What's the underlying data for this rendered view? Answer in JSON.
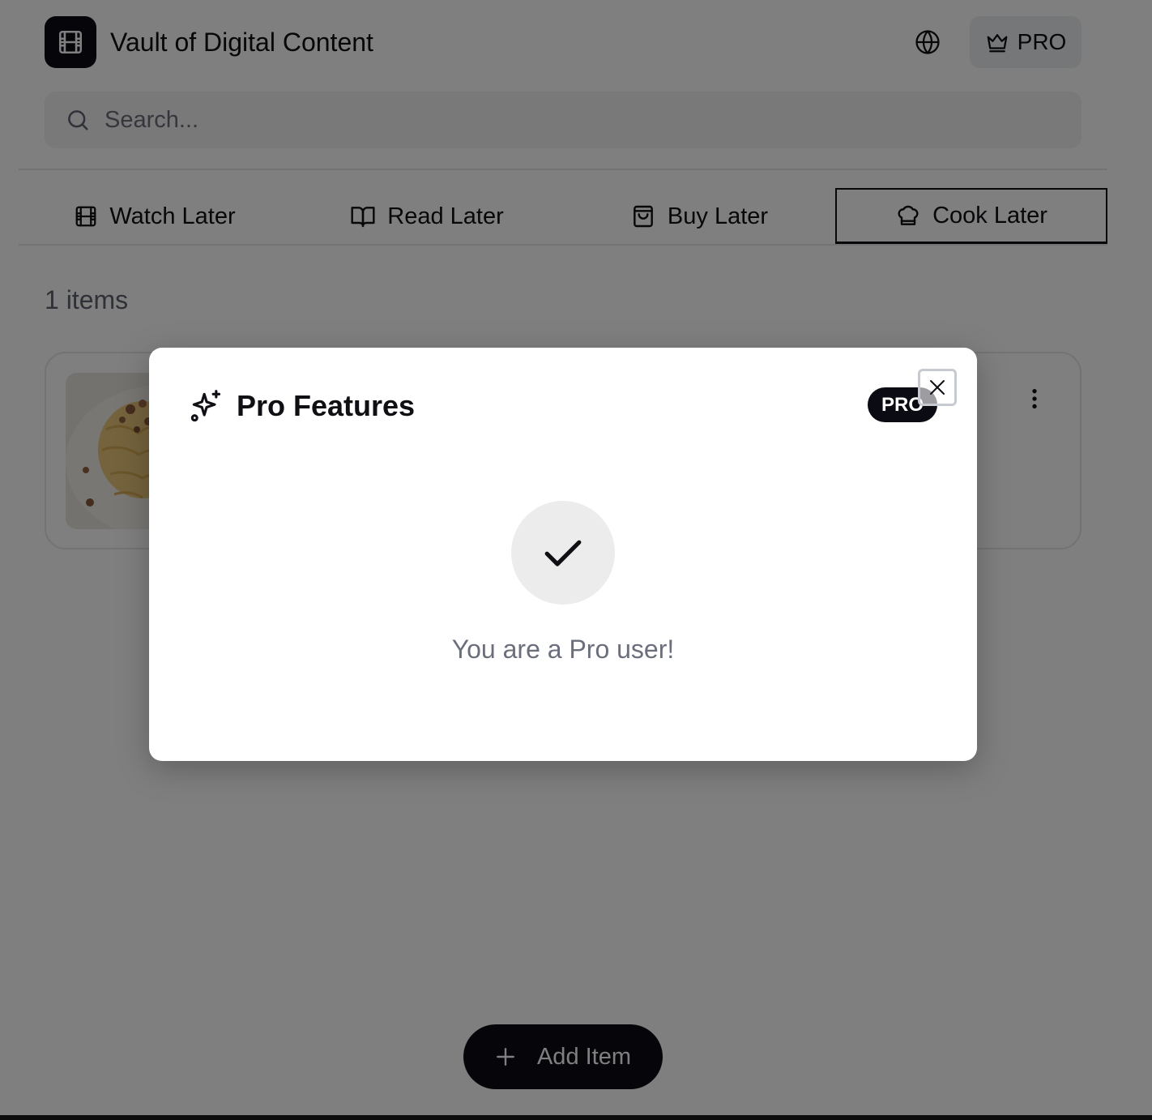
{
  "app": {
    "title": "Vault of Digital Content",
    "logo_icon": "film-icon"
  },
  "header": {
    "language_icon": "globe-icon",
    "pro_button": {
      "label": "PRO",
      "icon": "crown-icon"
    }
  },
  "search": {
    "placeholder": "Search...",
    "value": "",
    "icon": "search-icon"
  },
  "tabs": [
    {
      "label": "Watch Later",
      "icon": "film-icon",
      "active": false
    },
    {
      "label": "Read Later",
      "icon": "book-open-icon",
      "active": false
    },
    {
      "label": "Buy Later",
      "icon": "shopping-bag-icon",
      "active": false
    },
    {
      "label": "Cook Later",
      "icon": "chef-hat-icon",
      "active": true
    }
  ],
  "items": {
    "count_label": "1 items",
    "list": [
      {
        "thumbnail": "pasta-thumbnail",
        "menu_icon": "more-vertical-icon"
      }
    ]
  },
  "add_button": {
    "label": "Add Item",
    "icon": "plus-icon"
  },
  "modal": {
    "title": "Pro Features",
    "title_icon": "sparkles-icon",
    "badge": "PRO",
    "close_icon": "close-icon",
    "status_icon": "check-icon",
    "message": "You are a Pro user!"
  },
  "colors": {
    "primary": "#0b0b14",
    "muted_text": "#6b6f7b",
    "surface": "#f2f3f5",
    "overlay": "rgba(0,0,0,0.5)"
  }
}
